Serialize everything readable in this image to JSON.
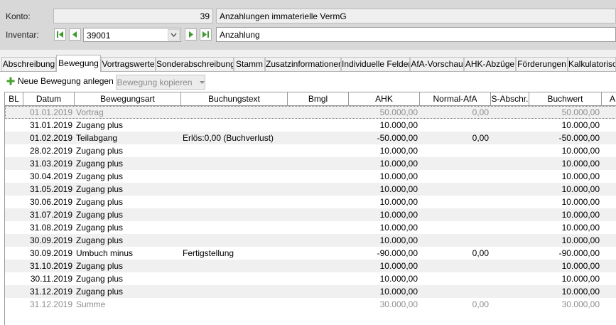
{
  "header": {
    "konto_label": "Konto:",
    "konto_number": "39",
    "konto_name": "Anzahlungen immaterielle VermG",
    "inventar_label": "Inventar:",
    "inventar_number": "39001",
    "inventar_name": "Anzahlung"
  },
  "tabs": [
    "Abschreibung",
    "Bewegung",
    "Vortragswerte",
    "Sonderabschreibung",
    "Stamm",
    "Zusatzinformationen",
    "Individuelle Felder",
    "AfA-Vorschau",
    "AHK-Abzüge",
    "Förderungen",
    "Kalkulatorisch"
  ],
  "active_tab": "Bewegung",
  "toolbar": {
    "new_label": "Neue Bewegung anlegen",
    "copy_label": "Bewegung kopieren"
  },
  "columns": [
    "BL",
    "Datum",
    "Bewegungsart",
    "Buchungstext",
    "Bmgl",
    "AHK",
    "Normal-AfA",
    "S-Abschr.",
    "Buchwert",
    "A"
  ],
  "rows": [
    {
      "datum": "01.01.2019",
      "art": "Vortrag",
      "text": "",
      "ahk": "50.000,00",
      "afa": "0,00",
      "wert": "50.000,00",
      "grey": true
    },
    {
      "datum": "31.01.2019",
      "art": "Zugang plus",
      "text": "",
      "ahk": "10.000,00",
      "afa": "",
      "wert": "10.000,00"
    },
    {
      "datum": "01.02.2019",
      "art": "Teilabgang",
      "text": "Erlös:0,00 (Buchverlust)",
      "ahk": "-50.000,00",
      "afa": "0,00",
      "wert": "-50.000,00"
    },
    {
      "datum": "28.02.2019",
      "art": "Zugang plus",
      "text": "",
      "ahk": "10.000,00",
      "afa": "",
      "wert": "10.000,00"
    },
    {
      "datum": "31.03.2019",
      "art": "Zugang plus",
      "text": "",
      "ahk": "10.000,00",
      "afa": "",
      "wert": "10.000,00"
    },
    {
      "datum": "30.04.2019",
      "art": "Zugang plus",
      "text": "",
      "ahk": "10.000,00",
      "afa": "",
      "wert": "10.000,00"
    },
    {
      "datum": "31.05.2019",
      "art": "Zugang plus",
      "text": "",
      "ahk": "10.000,00",
      "afa": "",
      "wert": "10.000,00"
    },
    {
      "datum": "30.06.2019",
      "art": "Zugang plus",
      "text": "",
      "ahk": "10.000,00",
      "afa": "",
      "wert": "10.000,00"
    },
    {
      "datum": "31.07.2019",
      "art": "Zugang plus",
      "text": "",
      "ahk": "10.000,00",
      "afa": "",
      "wert": "10.000,00"
    },
    {
      "datum": "31.08.2019",
      "art": "Zugang plus",
      "text": "",
      "ahk": "10.000,00",
      "afa": "",
      "wert": "10.000,00"
    },
    {
      "datum": "30.09.2019",
      "art": "Zugang plus",
      "text": "",
      "ahk": "10.000,00",
      "afa": "",
      "wert": "10.000,00"
    },
    {
      "datum": "30.09.2019",
      "art": "Umbuch minus",
      "text": "Fertigstellung",
      "ahk": "-90.000,00",
      "afa": "0,00",
      "wert": "-90.000,00"
    },
    {
      "datum": "31.10.2019",
      "art": "Zugang plus",
      "text": "",
      "ahk": "10.000,00",
      "afa": "",
      "wert": "10.000,00"
    },
    {
      "datum": "30.11.2019",
      "art": "Zugang plus",
      "text": "",
      "ahk": "10.000,00",
      "afa": "",
      "wert": "10.000,00"
    },
    {
      "datum": "31.12.2019",
      "art": "Zugang plus",
      "text": "",
      "ahk": "10.000,00",
      "afa": "",
      "wert": "10.000,00"
    },
    {
      "datum": "31.12.2019",
      "art": "Summe",
      "text": "",
      "ahk": "30.000,00",
      "afa": "0,00",
      "wert": "30.000,00",
      "grey": true
    }
  ],
  "icons": {
    "first": "first-record-icon",
    "prev": "previous-record-icon",
    "next": "next-record-icon",
    "last": "last-record-icon",
    "dropdown": "chevron-down-icon",
    "add": "plus-icon"
  },
  "colors": {
    "nav_green": "#3c9a2c",
    "add_green": "#48a02e",
    "row_alt": "#f0f0f0",
    "muted_text": "#8e8e8e"
  }
}
